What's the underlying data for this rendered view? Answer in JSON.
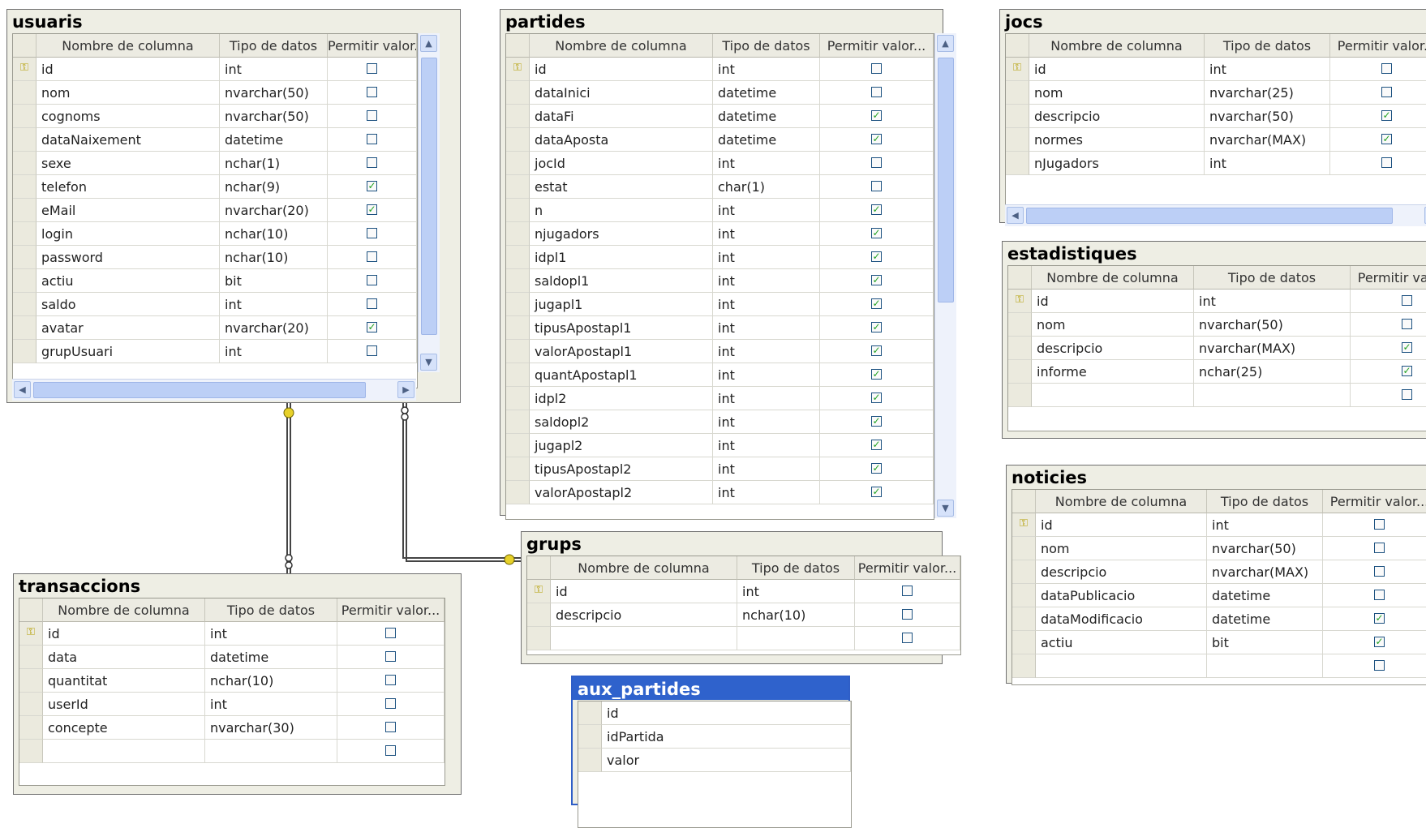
{
  "headers": {
    "column": "Nombre de columna",
    "type": "Tipo de datos",
    "nullable": "Permitir valor...",
    "nullable_short": "Permitir valor."
  },
  "tables": {
    "usuaris": {
      "title": "usuaris",
      "rows": [
        {
          "name": "id",
          "type": "int",
          "nulls": false,
          "pk": true
        },
        {
          "name": "nom",
          "type": "nvarchar(50)",
          "nulls": false
        },
        {
          "name": "cognoms",
          "type": "nvarchar(50)",
          "nulls": false
        },
        {
          "name": "dataNaixement",
          "type": "datetime",
          "nulls": false
        },
        {
          "name": "sexe",
          "type": "nchar(1)",
          "nulls": false
        },
        {
          "name": "telefon",
          "type": "nchar(9)",
          "nulls": true
        },
        {
          "name": "eMail",
          "type": "nvarchar(20)",
          "nulls": true
        },
        {
          "name": "login",
          "type": "nchar(10)",
          "nulls": false
        },
        {
          "name": "password",
          "type": "nchar(10)",
          "nulls": false
        },
        {
          "name": "actiu",
          "type": "bit",
          "nulls": false
        },
        {
          "name": "saldo",
          "type": "int",
          "nulls": false
        },
        {
          "name": "avatar",
          "type": "nvarchar(20)",
          "nulls": true
        },
        {
          "name": "grupUsuari",
          "type": "int",
          "nulls": false
        }
      ]
    },
    "partides": {
      "title": "partides",
      "rows": [
        {
          "name": "id",
          "type": "int",
          "nulls": false,
          "pk": true
        },
        {
          "name": "dataInici",
          "type": "datetime",
          "nulls": false
        },
        {
          "name": "dataFi",
          "type": "datetime",
          "nulls": true
        },
        {
          "name": "dataAposta",
          "type": "datetime",
          "nulls": true
        },
        {
          "name": "jocId",
          "type": "int",
          "nulls": false
        },
        {
          "name": "estat",
          "type": "char(1)",
          "nulls": false
        },
        {
          "name": "n",
          "type": "int",
          "nulls": true
        },
        {
          "name": "njugadors",
          "type": "int",
          "nulls": true
        },
        {
          "name": "idpl1",
          "type": "int",
          "nulls": true
        },
        {
          "name": "saldopl1",
          "type": "int",
          "nulls": true
        },
        {
          "name": "jugapl1",
          "type": "int",
          "nulls": true
        },
        {
          "name": "tipusApostapl1",
          "type": "int",
          "nulls": true
        },
        {
          "name": "valorApostapl1",
          "type": "int",
          "nulls": true
        },
        {
          "name": "quantApostapl1",
          "type": "int",
          "nulls": true
        },
        {
          "name": "idpl2",
          "type": "int",
          "nulls": true
        },
        {
          "name": "saldopl2",
          "type": "int",
          "nulls": true
        },
        {
          "name": "jugapl2",
          "type": "int",
          "nulls": true
        },
        {
          "name": "tipusApostapl2",
          "type": "int",
          "nulls": true
        },
        {
          "name": "valorApostapl2",
          "type": "int",
          "nulls": true
        }
      ]
    },
    "jocs": {
      "title": "jocs",
      "rows": [
        {
          "name": "id",
          "type": "int",
          "nulls": false,
          "pk": true
        },
        {
          "name": "nom",
          "type": "nvarchar(25)",
          "nulls": false
        },
        {
          "name": "descripcio",
          "type": "nvarchar(50)",
          "nulls": true
        },
        {
          "name": "normes",
          "type": "nvarchar(MAX)",
          "nulls": true
        },
        {
          "name": "nJugadors",
          "type": "int",
          "nulls": false
        }
      ]
    },
    "estadistiques": {
      "title": "estadistiques",
      "rows": [
        {
          "name": "id",
          "type": "int",
          "nulls": false,
          "pk": true
        },
        {
          "name": "nom",
          "type": "nvarchar(50)",
          "nulls": false
        },
        {
          "name": "descripcio",
          "type": "nvarchar(MAX)",
          "nulls": true
        },
        {
          "name": "informe",
          "type": "nchar(25)",
          "nulls": true
        },
        {
          "name": "",
          "type": "",
          "nulls": false
        }
      ]
    },
    "noticies": {
      "title": "noticies",
      "rows": [
        {
          "name": "id",
          "type": "int",
          "nulls": false,
          "pk": true
        },
        {
          "name": "nom",
          "type": "nvarchar(50)",
          "nulls": false
        },
        {
          "name": "descripcio",
          "type": "nvarchar(MAX)",
          "nulls": false
        },
        {
          "name": "dataPublicacio",
          "type": "datetime",
          "nulls": false
        },
        {
          "name": "dataModificacio",
          "type": "datetime",
          "nulls": true
        },
        {
          "name": "actiu",
          "type": "bit",
          "nulls": true
        },
        {
          "name": "",
          "type": "",
          "nulls": false
        }
      ]
    },
    "grups": {
      "title": "grups",
      "rows": [
        {
          "name": "id",
          "type": "int",
          "nulls": false,
          "pk": true
        },
        {
          "name": "descripcio",
          "type": "nchar(10)",
          "nulls": false
        },
        {
          "name": "",
          "type": "",
          "nulls": false
        }
      ]
    },
    "transaccions": {
      "title": "transaccions",
      "rows": [
        {
          "name": "id",
          "type": "int",
          "nulls": false,
          "pk": true
        },
        {
          "name": "data",
          "type": "datetime",
          "nulls": false
        },
        {
          "name": "quantitat",
          "type": "nchar(10)",
          "nulls": false
        },
        {
          "name": "userId",
          "type": "int",
          "nulls": false
        },
        {
          "name": "concepte",
          "type": "nvarchar(30)",
          "nulls": false
        },
        {
          "name": "",
          "type": "",
          "nulls": false
        }
      ]
    },
    "aux_partides": {
      "title": "aux_partides",
      "rows": [
        {
          "name": "id"
        },
        {
          "name": "idPartida"
        },
        {
          "name": "valor"
        }
      ]
    }
  },
  "icons": {
    "key": "key-icon",
    "check": "check-icon",
    "scroll_up": "chevron-up-icon",
    "scroll_down": "chevron-down-icon",
    "scroll_left": "chevron-left-icon",
    "scroll_right": "chevron-right-icon",
    "relation_end_one": "key-end-icon",
    "relation_end_many": "infinity-end-icon"
  },
  "colors": {
    "title_selected": "#2f62cc",
    "relation_key": "#e7d12a",
    "checkbox_check": "#21a121",
    "pane_background": "#eeeee4"
  }
}
